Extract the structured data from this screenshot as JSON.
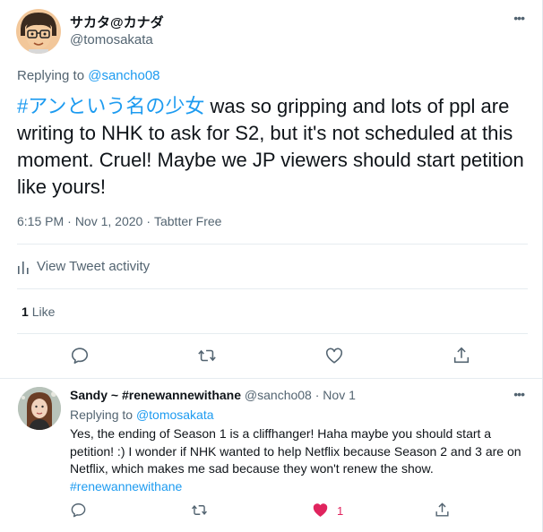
{
  "main_tweet": {
    "display_name": "サカタ@カナダ",
    "handle": "@tomosakata",
    "replying_label": "Replying to ",
    "replying_to": "@sancho08",
    "hashtag": "#アンという名の少女",
    "text": " was so gripping and lots of ppl are writing to NHK to ask for S2, but it's not scheduled at this moment. Cruel! Maybe we JP viewers should start petition like yours!",
    "time": "6:15 PM",
    "date": "Nov 1, 2020",
    "client": "Tabtter Free",
    "activity_label": "View Tweet activity",
    "like_count": "1",
    "like_label": "Like",
    "more_icon": "•••"
  },
  "reply_tweet": {
    "display_name": "Sandy ~ #renewannewithane",
    "handle": "@sancho08",
    "date": "Nov 1",
    "replying_label": "Replying to ",
    "replying_to": "@tomosakata",
    "text": "Yes, the ending of Season 1 is a cliffhanger! Haha maybe you should start a petition! :) I wonder if NHK wanted to help Netflix because Season 2 and 3 are on Netflix, which makes me sad because they won't renew the show.",
    "hashtag": "#renewannewithane",
    "like_count": "1",
    "more_icon": "•••"
  },
  "icons": {
    "reply": "reply-icon",
    "retweet": "retweet-icon",
    "like": "heart-icon",
    "share": "share-icon",
    "activity": "bar-chart-icon"
  },
  "colors": {
    "link": "#1d9bf0",
    "like_active": "#e0245e",
    "secondary_text": "#536471",
    "divider": "#e6ecf0"
  }
}
